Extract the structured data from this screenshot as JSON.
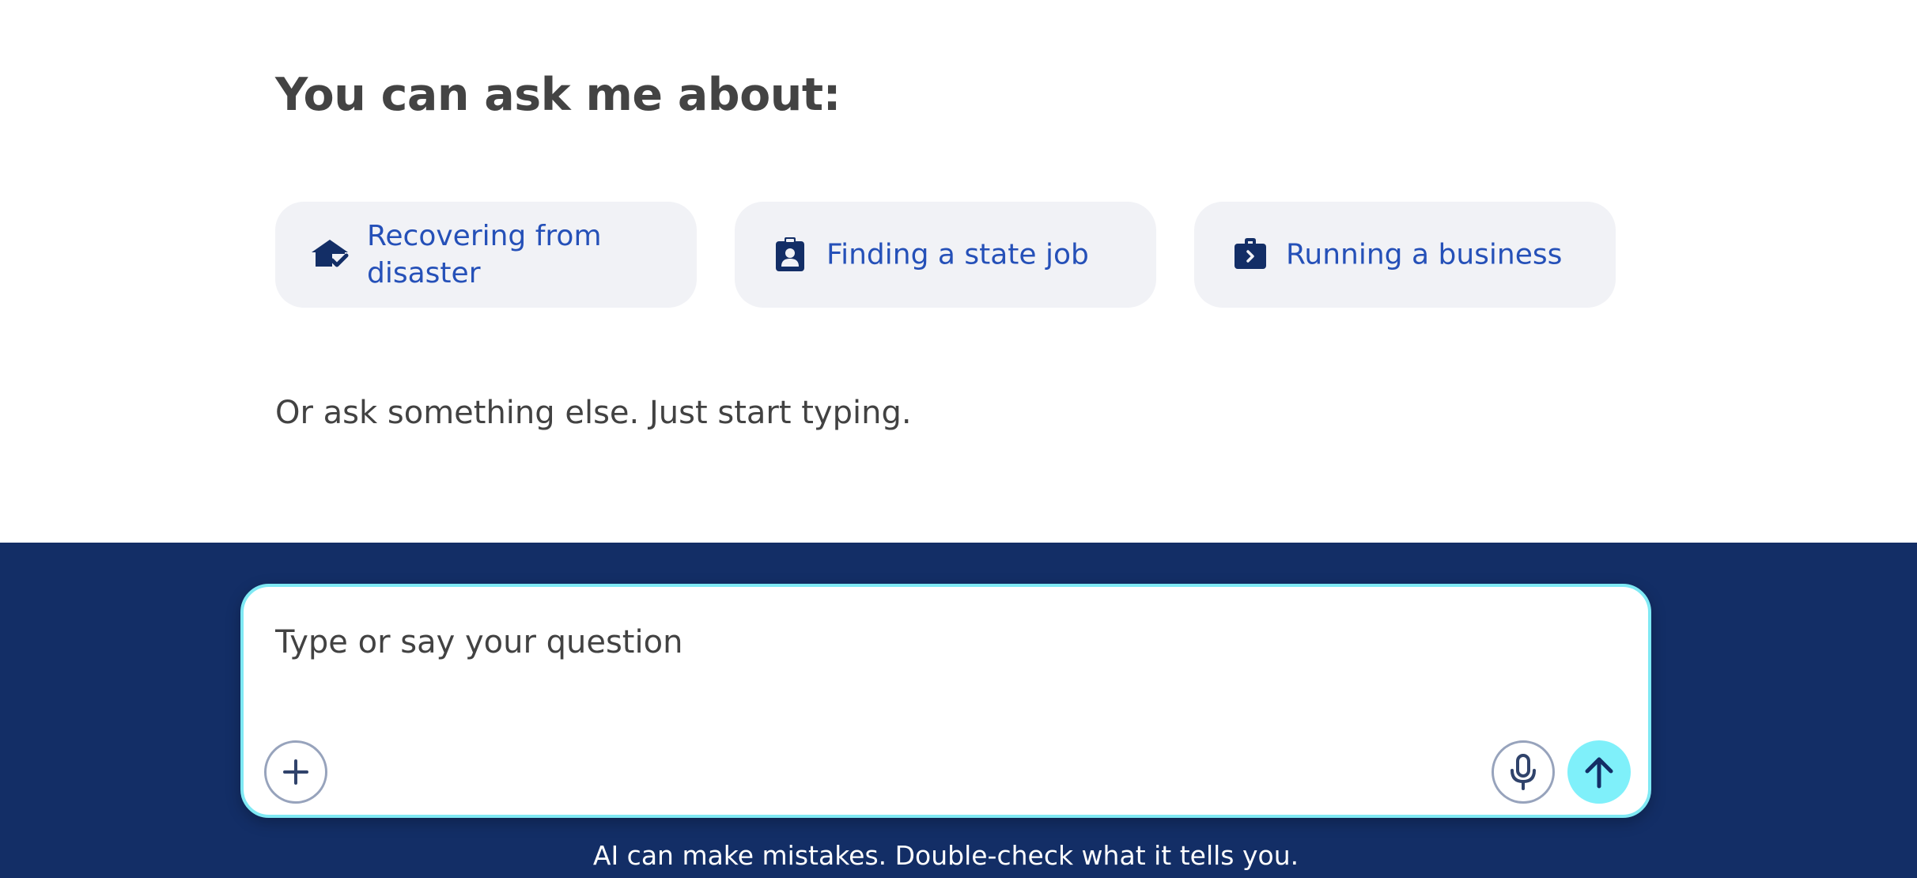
{
  "prompt": {
    "heading": "You can ask me about:",
    "subtext": "Or ask something else. Just start typing."
  },
  "suggestions": [
    {
      "label": "Recovering from disaster",
      "icon": "house-check-icon"
    },
    {
      "label": "Finding a state job",
      "icon": "id-badge-icon"
    },
    {
      "label": "Running a business",
      "icon": "briefcase-icon"
    }
  ],
  "composer": {
    "placeholder": "Type or say your question",
    "add_icon": "plus-icon",
    "mic_icon": "microphone-icon",
    "send_icon": "arrow-up-icon"
  },
  "footer": {
    "disclaimer": "AI can make mistakes. Double-check what it tells you."
  },
  "colors": {
    "accent_text": "#2550b8",
    "icon_navy": "#132e66",
    "footer_bg": "#132e66",
    "chip_bg": "#f1f2f6",
    "input_border": "#7fe9f4",
    "send_bg": "#7ff0fa"
  }
}
